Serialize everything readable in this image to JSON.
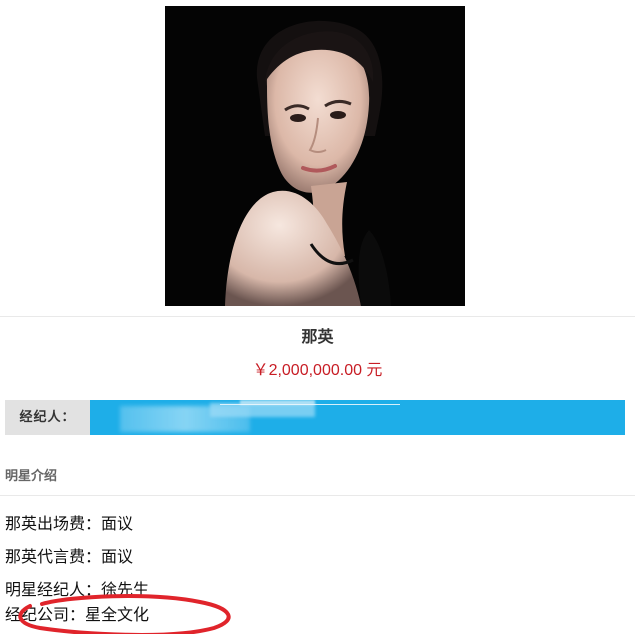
{
  "profile": {
    "name": "那英",
    "price": "￥2,000,000.00 元"
  },
  "agent": {
    "label": "经纪人："
  },
  "intro": {
    "section_title": "明星介绍",
    "lines": [
      "那英出场费：面议",
      "那英代言费：面议",
      "明星经纪人：徐先生",
      "经纪公司：星全文化"
    ]
  },
  "colors": {
    "price": "#c81d25",
    "agent_bar": "#1eaee8",
    "agent_label_bg": "#e2e2e2",
    "annotation": "#e0242b"
  },
  "icons": {
    "photo": "celebrity-portrait-photo",
    "annotation": "red-circle-annotation"
  }
}
